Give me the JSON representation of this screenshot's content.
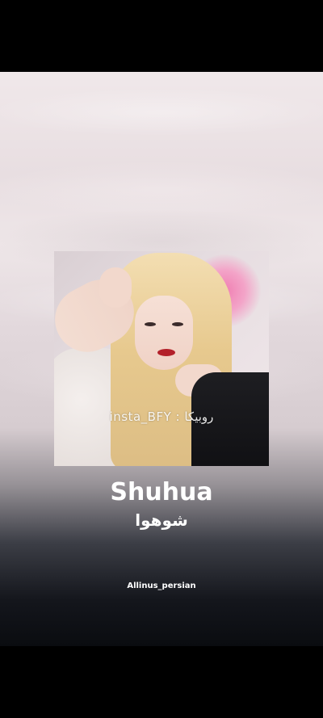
{
  "story": {
    "photo_watermark": "insta_BFY : روبیکا",
    "title": "Shuhua",
    "subtitle": "شوهوا",
    "credit": "Allinus_persian"
  },
  "colors": {
    "background_top": "#efe7e9",
    "background_bottom": "#0a0c10",
    "text": "#ffffff",
    "letterbox": "#000000"
  }
}
